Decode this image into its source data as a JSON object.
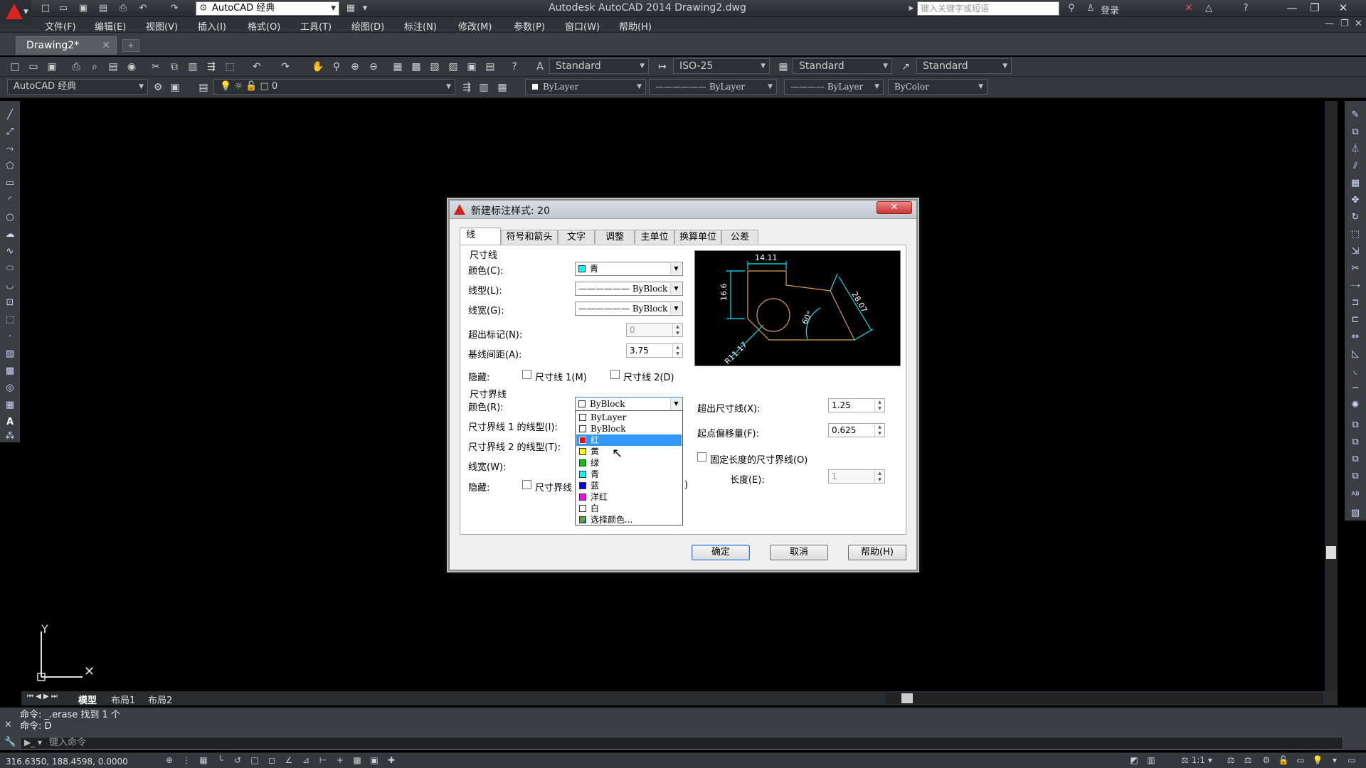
{
  "titlebar": {
    "workspace": "AutoCAD 经典",
    "title": "Autodesk AutoCAD 2014    Drawing2.dwg",
    "search_placeholder": "键入关键字或短语",
    "login": "登录"
  },
  "menu": [
    "文件(F)",
    "编辑(E)",
    "视图(V)",
    "插入(I)",
    "格式(O)",
    "工具(T)",
    "绘图(D)",
    "标注(N)",
    "修改(M)",
    "参数(P)",
    "窗口(W)",
    "帮助(H)"
  ],
  "doc_tab": "Drawing2*",
  "toolbar": {
    "text_style": "Standard",
    "dim_style": "ISO-25",
    "table_style": "Standard",
    "multileader_style": "Standard",
    "workspace2": "AutoCAD 经典",
    "layer": "0",
    "color": "ByLayer",
    "linetype": "ByLayer",
    "lineweight": "ByLayer",
    "plotstyle": "ByColor"
  },
  "layout_tabs": [
    "模型",
    "布局1",
    "布局2"
  ],
  "command": {
    "history": [
      "命令: _.erase 找到 1 个",
      "命令: D"
    ],
    "placeholder": "键入命令"
  },
  "status": {
    "coords": "316.6350, 188.4598, 0.0000",
    "scale": "1:1"
  },
  "dialog": {
    "title": "新建标注样式: 20",
    "tabs": [
      "线",
      "符号和箭头",
      "文字",
      "调整",
      "主单位",
      "换算单位",
      "公差"
    ],
    "dimline": {
      "group": "尺寸线",
      "color_label": "颜色(C):",
      "color_value": "青",
      "linetype_label": "线型(L):",
      "linetype_value": "ByBlock",
      "lineweight_label": "线宽(G):",
      "lineweight_value": "ByBlock",
      "extend_label": "超出标记(N):",
      "extend_value": "0",
      "baseline_label": "基线间距(A):",
      "baseline_value": "3.75",
      "suppress_label": "隐藏:",
      "suppress1": "尺寸线 1(M)",
      "suppress2": "尺寸线 2(D)"
    },
    "extline": {
      "group": "尺寸界线",
      "color_label": "颜色(R):",
      "color_value": "ByBlock",
      "lt1_label": "尺寸界线 1 的线型(I):",
      "lt2_label": "尺寸界线 2 的线型(T):",
      "lw_label": "线宽(W):",
      "suppress_label": "隐藏:",
      "suppress1": "尺寸界线",
      "suppress2_tail": ")",
      "beyond_label": "超出尺寸线(X):",
      "beyond_value": "1.25",
      "offset_label": "起点偏移量(F):",
      "offset_value": "0.625",
      "fixed_label": "固定长度的尺寸界线(O)",
      "length_label": "长度(E):",
      "length_value": "1"
    },
    "dropdown": [
      {
        "label": "ByLayer",
        "color": "#ffffff"
      },
      {
        "label": "ByBlock",
        "color": "#ffffff"
      },
      {
        "label": "红",
        "color": "#ff0000"
      },
      {
        "label": "黄",
        "color": "#ffff00"
      },
      {
        "label": "绿",
        "color": "#00cc00"
      },
      {
        "label": "青",
        "color": "#00ffff"
      },
      {
        "label": "蓝",
        "color": "#0000ff"
      },
      {
        "label": "洋红",
        "color": "#ff00ff"
      },
      {
        "label": "白",
        "color": "#ffffff"
      },
      {
        "label": "选择颜色...",
        "color": "#3a7"
      }
    ],
    "preview": {
      "dim_top": "14.11",
      "dim_left": "16.6",
      "dim_diag": "28.07",
      "dim_angle": "60°",
      "dim_radius": "R11.17"
    },
    "buttons": {
      "ok": "确定",
      "cancel": "取消",
      "help": "帮助(H)"
    }
  }
}
